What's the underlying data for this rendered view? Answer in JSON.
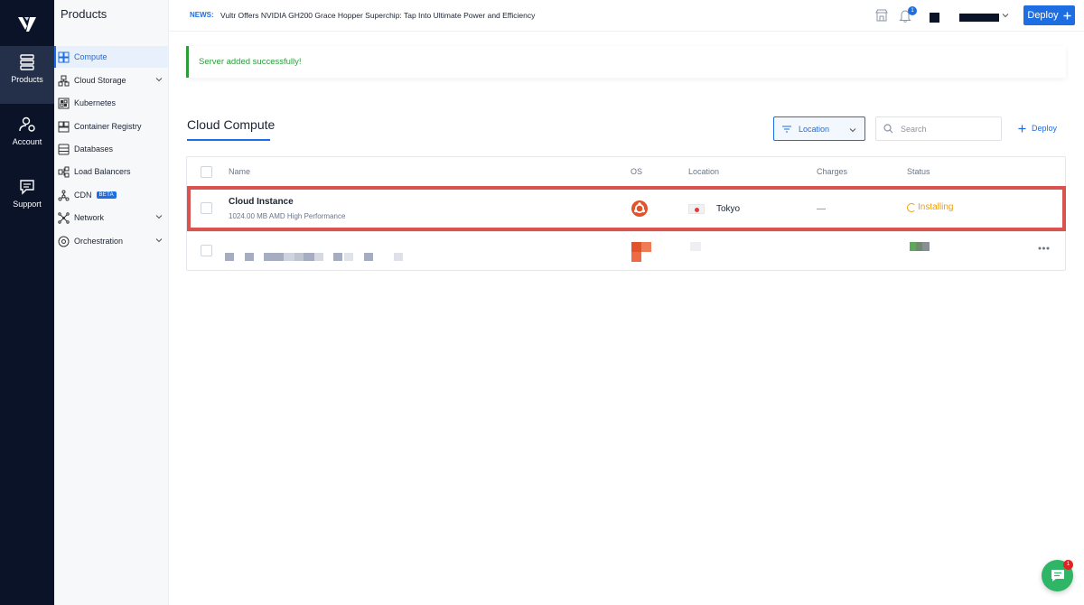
{
  "colors": {
    "rail_bg": "#0b1329",
    "accent": "#1d6ee3",
    "success": "#2a9d3a",
    "warning": "#f0a000",
    "highlight": "#d9534f",
    "chat": "#2fb566"
  },
  "rail": {
    "logo_icon": "vultr-logo-icon",
    "items": [
      {
        "label": "Products",
        "icon": "server-stack-icon",
        "active": true
      },
      {
        "label": "Account",
        "icon": "account-gear-icon"
      },
      {
        "label": "Support",
        "icon": "support-chat-icon"
      }
    ]
  },
  "sidebar": {
    "title": "Products",
    "items": [
      {
        "label": "Compute",
        "icon": "compute-icon",
        "active": true
      },
      {
        "label": "Cloud Storage",
        "icon": "storage-icon",
        "expandable": true
      },
      {
        "label": "Kubernetes",
        "icon": "kubernetes-icon"
      },
      {
        "label": "Container Registry",
        "icon": "registry-icon"
      },
      {
        "label": "Databases",
        "icon": "database-icon"
      },
      {
        "label": "Load Balancers",
        "icon": "load-balancer-icon"
      },
      {
        "label": "CDN",
        "icon": "cdn-icon",
        "badge": "BETA"
      },
      {
        "label": "Network",
        "icon": "network-icon",
        "expandable": true
      },
      {
        "label": "Orchestration",
        "icon": "orchestration-icon",
        "expandable": true
      }
    ]
  },
  "topbar": {
    "news_tag": "NEWS:",
    "news_text": "Vultr Offers NVIDIA GH200 Grace Hopper Superchip: Tap Into Ultimate Power and Efficiency",
    "notification_count": "1",
    "deploy_label": "Deploy",
    "deploy_icon": "plus-icon"
  },
  "alert": {
    "message": "Server added successfully!"
  },
  "compute": {
    "title": "Cloud Compute",
    "location_filter": "Location",
    "search_placeholder": "Search",
    "deploy_link": "Deploy",
    "columns": [
      "Name",
      "OS",
      "Location",
      "Charges",
      "Status"
    ],
    "rows": [
      {
        "name": "Cloud Instance",
        "subtitle": "1024.00 MB AMD High Performance",
        "os_icon": "ubuntu-icon",
        "location_flag": "japan-flag-icon",
        "location": "Tokyo",
        "charges": "—",
        "status": "Installing",
        "highlighted": true
      },
      {
        "name": "",
        "subtitle": "",
        "obscured": true,
        "os_icon": "pixelated-os-icon",
        "actions_icon": "more-dots-icon"
      }
    ]
  },
  "chat": {
    "icon": "chat-icon",
    "badge": "1"
  }
}
